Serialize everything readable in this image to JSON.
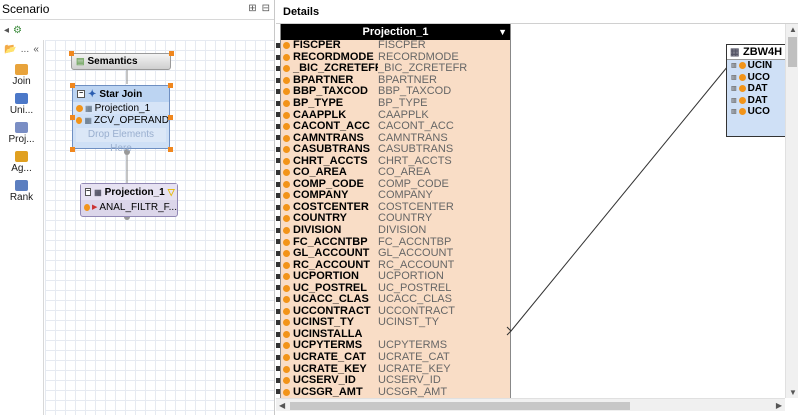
{
  "scenario": {
    "title": "Scenario",
    "palette": {
      "expander": "...",
      "items": [
        {
          "label": "Join",
          "color": "#e8a33b"
        },
        {
          "label": "Uni...",
          "color": "#4c78c8"
        },
        {
          "label": "Proj...",
          "color": "#7a8ec4"
        },
        {
          "label": "Ag...",
          "color": "#e0a020"
        },
        {
          "label": "Rank",
          "color": "#5c7fc0"
        }
      ]
    },
    "nodes": {
      "semantics": {
        "title": "Semantics"
      },
      "star_join": {
        "title": "Star Join",
        "items": [
          "Projection_1",
          "ZCV_OPERAND"
        ],
        "drop_text": "Drop Elements Here"
      },
      "projection": {
        "title": "Projection_1",
        "item": "ANAL_FILTR_F..."
      }
    }
  },
  "details": {
    "title": "Details",
    "projection_table": {
      "title": "Projection_1",
      "rows": [
        {
          "name": "FISCPER",
          "alias": "FISCPER"
        },
        {
          "name": "RECORDMODE",
          "alias": "RECORDMODE"
        },
        {
          "name": "_BIC_ZCRETEFR",
          "alias": "_BIC_ZCRETEFR"
        },
        {
          "name": "BPARTNER",
          "alias": "BPARTNER"
        },
        {
          "name": "BBP_TAXCOD",
          "alias": "BBP_TAXCOD"
        },
        {
          "name": "BP_TYPE",
          "alias": "BP_TYPE"
        },
        {
          "name": "CAAPPLK",
          "alias": "CAAPPLK"
        },
        {
          "name": "CACONT_ACC",
          "alias": "CACONT_ACC"
        },
        {
          "name": "CAMNTRANS",
          "alias": "CAMNTRANS"
        },
        {
          "name": "CASUBTRANS",
          "alias": "CASUBTRANS"
        },
        {
          "name": "CHRT_ACCTS",
          "alias": "CHRT_ACCTS"
        },
        {
          "name": "CO_AREA",
          "alias": "CO_AREA"
        },
        {
          "name": "COMP_CODE",
          "alias": "COMP_CODE"
        },
        {
          "name": "COMPANY",
          "alias": "COMPANY"
        },
        {
          "name": "COSTCENTER",
          "alias": "COSTCENTER"
        },
        {
          "name": "COUNTRY",
          "alias": "COUNTRY"
        },
        {
          "name": "DIVISION",
          "alias": "DIVISION"
        },
        {
          "name": "FC_ACCNTBP",
          "alias": "FC_ACCNTBP"
        },
        {
          "name": "GL_ACCOUNT",
          "alias": "GL_ACCOUNT"
        },
        {
          "name": "RC_ACCOUNT",
          "alias": "RC_ACCOUNT"
        },
        {
          "name": "UCPORTION",
          "alias": "UCPORTION"
        },
        {
          "name": "UC_POSTREL",
          "alias": "UC_POSTREL"
        },
        {
          "name": "UCACC_CLAS",
          "alias": "UCACC_CLAS"
        },
        {
          "name": "UCCONTRACT",
          "alias": "UCCONTRACT"
        },
        {
          "name": "UCINST_TY",
          "alias": "UCINST_TY"
        },
        {
          "name": "UCINSTALLA",
          "alias": ""
        },
        {
          "name": "UCPYTERMS",
          "alias": "UCPYTERMS"
        },
        {
          "name": "UCRATE_CAT",
          "alias": "UCRATE_CAT"
        },
        {
          "name": "UCRATE_KEY",
          "alias": "UCRATE_KEY"
        },
        {
          "name": "UCSERV_ID",
          "alias": "UCSERV_ID"
        },
        {
          "name": "UCSGR_AMT",
          "alias": "UCSGR_AMT"
        }
      ]
    },
    "target_table": {
      "title": "ZBW4H",
      "rows": [
        "UCIN",
        "UCO",
        "DAT",
        "DAT",
        "UCO"
      ]
    }
  }
}
